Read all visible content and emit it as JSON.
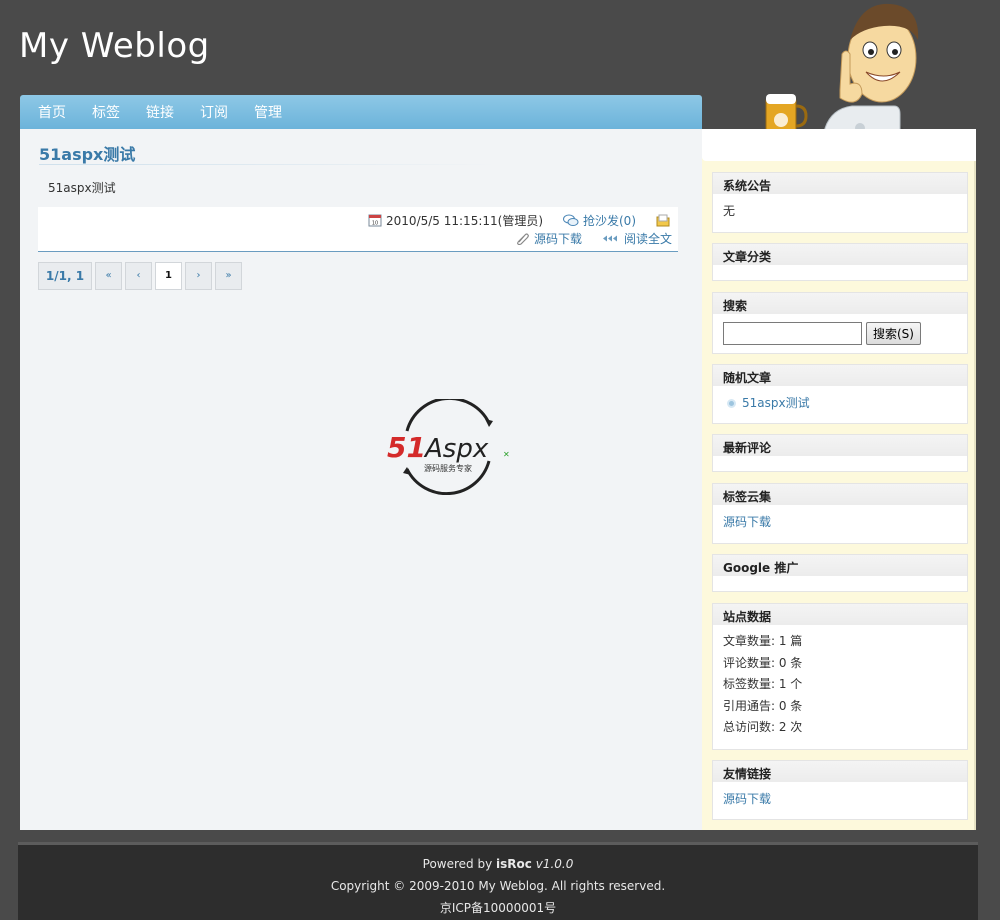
{
  "site": {
    "title": "My Weblog"
  },
  "nav": {
    "items": [
      "首页",
      "标签",
      "链接",
      "订阅",
      "管理"
    ]
  },
  "post": {
    "title": "51aspx测试",
    "body": "51aspx测试",
    "date": "2010/5/5 11:15:11(管理员)",
    "comment_label": "抢沙发(0)",
    "download_label": "源码下载",
    "read_more_label": "阅读全文"
  },
  "pager": {
    "info": "1/1, 1",
    "first": "«",
    "prev": "‹",
    "current": "1",
    "next": "›",
    "last": "»"
  },
  "logo": {
    "brand": "51Aspx",
    "tagline": "源码服务专家"
  },
  "sidebar": {
    "announcement": {
      "title": "系统公告",
      "content": "无"
    },
    "categories": {
      "title": "文章分类"
    },
    "search": {
      "title": "搜索",
      "button": "搜索(S)",
      "value": ""
    },
    "random": {
      "title": "随机文章",
      "items": [
        "51aspx测试"
      ]
    },
    "comments": {
      "title": "最新评论"
    },
    "tags": {
      "title": "标签云集",
      "items": [
        "源码下载"
      ]
    },
    "google": {
      "title": "Google 推广"
    },
    "stats": {
      "title": "站点数据",
      "lines": [
        "文章数量: 1 篇",
        "评论数量: 0 条",
        "标签数量: 1 个",
        "引用通告: 0 条",
        "总访问数: 2 次"
      ]
    },
    "links": {
      "title": "友情链接",
      "items": [
        "源码下载"
      ]
    }
  },
  "footer": {
    "powered_prefix": "Powered by ",
    "powered_name": "isRoc",
    "powered_version": " v1.0.0",
    "copyright": "Copyright © 2009-2010 My Weblog. All rights reserved.",
    "icp": "京ICP备10000001号"
  },
  "colors": {
    "accent": "#3a7aa8",
    "nav": "#7dbde0",
    "background": "#4a4a4a",
    "sidebar": "#fdf9dc"
  }
}
